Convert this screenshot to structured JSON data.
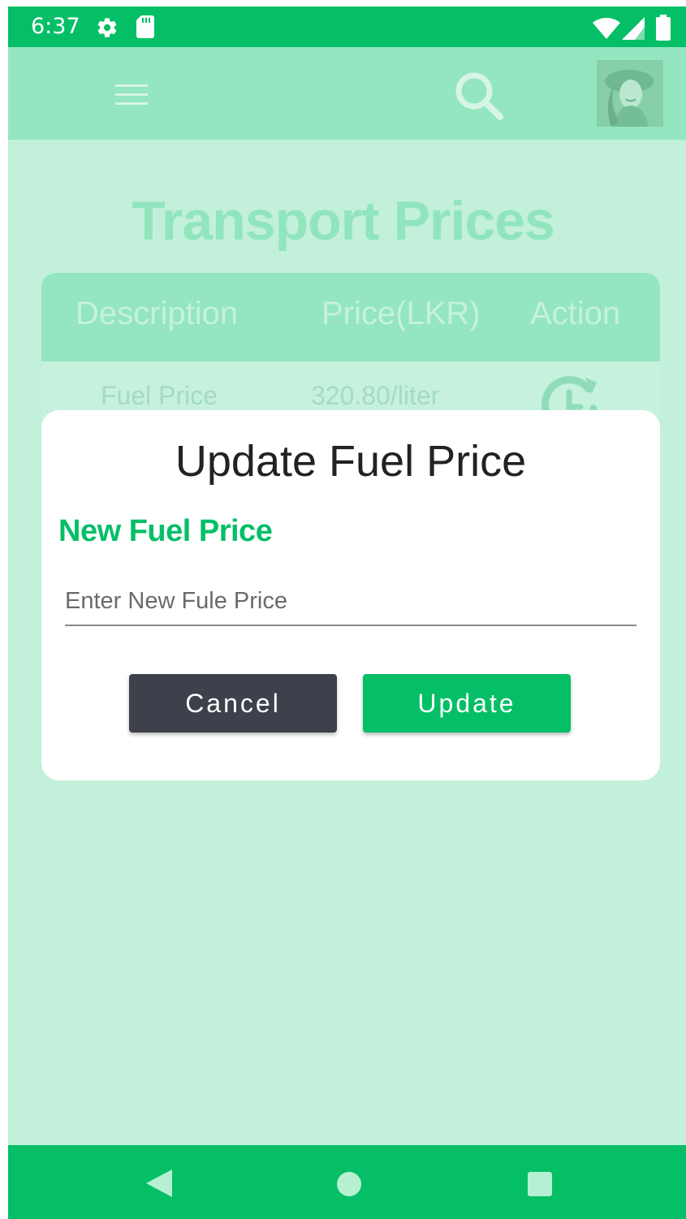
{
  "status_bar": {
    "time": "6:37",
    "icons": [
      "gear-icon",
      "sd-card-icon",
      "wifi-icon",
      "signal-icon",
      "battery-icon"
    ]
  },
  "app_header": {
    "icons": [
      "menu-icon",
      "search-icon"
    ],
    "avatar": "user-avatar"
  },
  "page": {
    "title": "Transport Prices"
  },
  "table": {
    "headers": [
      "Description",
      "Price(LKR)",
      "Action"
    ],
    "rows": [
      {
        "description": "Fuel Price",
        "price": "320.80/liter",
        "action_icon": "refresh-clock-icon"
      }
    ]
  },
  "dialog": {
    "title": "Update Fuel Price",
    "field_label": "New Fuel Price",
    "input_placeholder": "Enter New Fule Price",
    "input_value": "",
    "cancel_label": "Cancel",
    "update_label": "Update"
  },
  "nav_bar": {
    "icons": [
      "back-icon",
      "home-icon",
      "recents-icon"
    ]
  },
  "colors": {
    "accent": "#05bf67",
    "overlay_background": "#c2f0da",
    "dark_button": "#3e414b"
  }
}
